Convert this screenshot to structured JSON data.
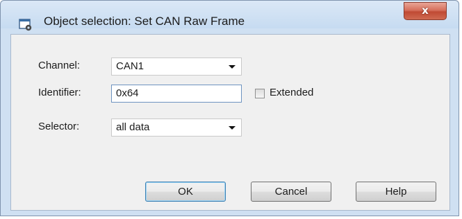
{
  "window": {
    "title": "Object selection: Set CAN Raw Frame",
    "title_icon": "settings-window-icon",
    "close_label": "x"
  },
  "form": {
    "channel": {
      "label": "Channel:",
      "value": "CAN1"
    },
    "identifier": {
      "label": "Identifier:",
      "value": "0x64",
      "extended_label": "Extended",
      "extended_checked": false
    },
    "selector": {
      "label": "Selector:",
      "value": "all data"
    }
  },
  "buttons": {
    "ok": "OK",
    "cancel": "Cancel",
    "help": "Help"
  }
}
